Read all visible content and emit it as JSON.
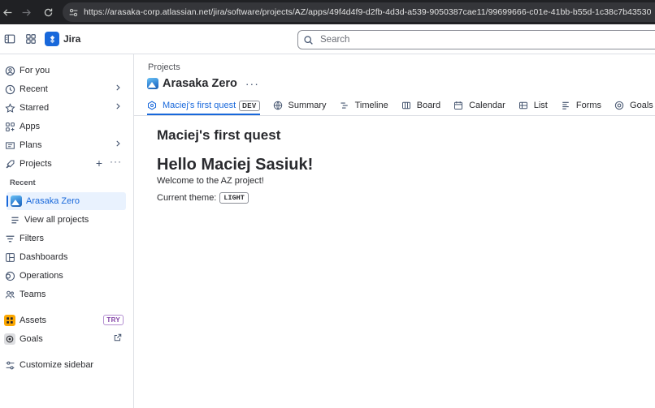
{
  "browser": {
    "url": "https://arasaka-corp.atlassian.net/jira/software/projects/AZ/apps/49f4d4f9-d2fb-4d3d-a539-9050387cae11/99699666-c01e-41bb-b55d-1c38c7b43530"
  },
  "topnav": {
    "product_name": "Jira",
    "search_placeholder": "Search"
  },
  "sidebar": {
    "for_you": "For you",
    "recent": "Recent",
    "starred": "Starred",
    "apps": "Apps",
    "plans": "Plans",
    "projects": "Projects",
    "recent_section": "Recent",
    "recent_project": "Arasaka Zero",
    "view_all_projects": "View all projects",
    "filters": "Filters",
    "dashboards": "Dashboards",
    "operations": "Operations",
    "teams": "Teams",
    "assets": "Assets",
    "assets_badge": "TRY",
    "goals": "Goals",
    "customize": "Customize sidebar"
  },
  "main": {
    "breadcrumb": "Projects",
    "project_title": "Arasaka Zero",
    "tabs": [
      {
        "label": "Maciej's first quest",
        "badge": "DEV",
        "icon": "app-icon",
        "active": true
      },
      {
        "label": "Summary",
        "icon": "globe-icon"
      },
      {
        "label": "Timeline",
        "icon": "timeline-icon"
      },
      {
        "label": "Board",
        "icon": "board-icon"
      },
      {
        "label": "Calendar",
        "icon": "calendar-icon"
      },
      {
        "label": "List",
        "icon": "list-icon"
      },
      {
        "label": "Forms",
        "icon": "forms-icon"
      },
      {
        "label": "Goals",
        "icon": "goal-icon"
      }
    ],
    "content": {
      "heading": "Maciej's first quest",
      "greeting": "Hello Maciej Sasiuk!",
      "welcome": "Welcome to the AZ project!",
      "theme_label": "Current theme:",
      "theme_value": "LIGHT"
    }
  },
  "colors": {
    "brand_blue": "#1868db",
    "browser_bg": "#202124",
    "selected_bg": "#e9f2fe",
    "assets_yellow": "#fca700",
    "try_purple": "#803fa5"
  }
}
